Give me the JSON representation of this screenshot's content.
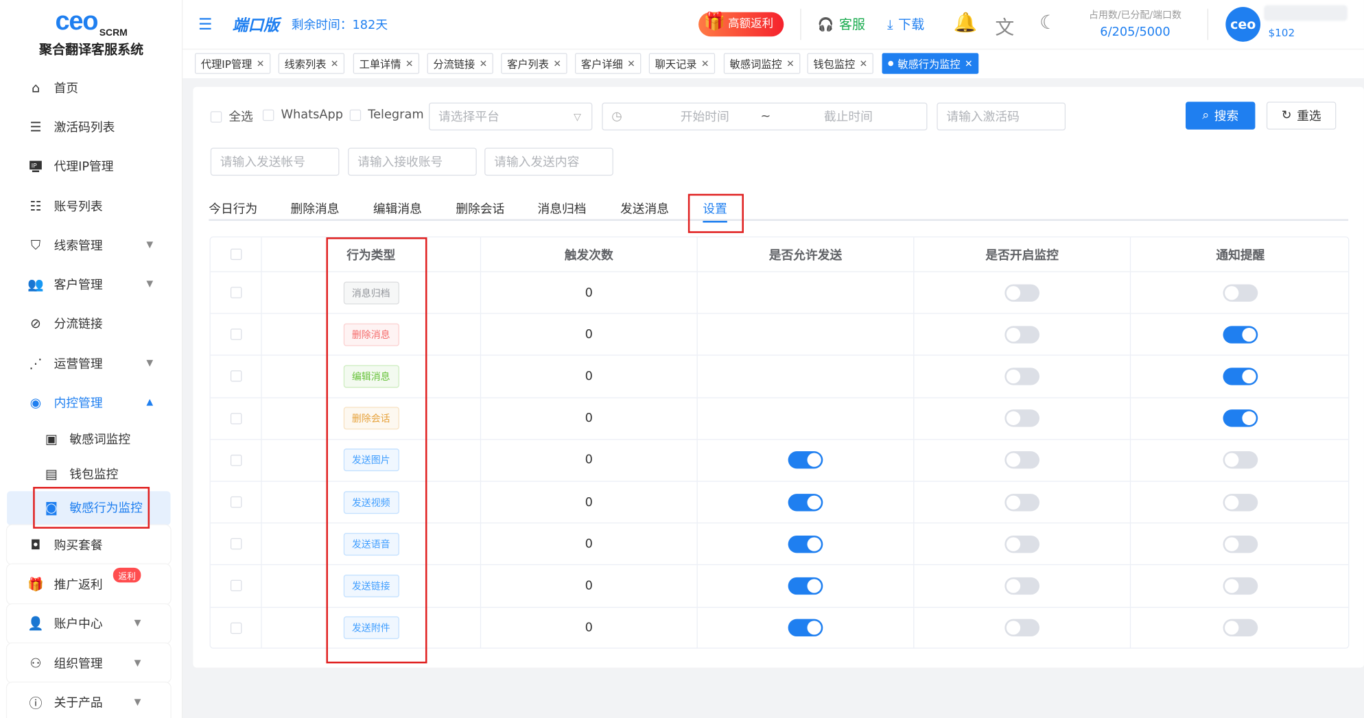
{
  "sidebar": {
    "logo_brand": "ceo",
    "logo_suffix": "SCRM",
    "system_name": "聚合翻译客服系统",
    "items": [
      {
        "label": "首页"
      },
      {
        "label": "激活码列表"
      },
      {
        "label": "代理IP管理"
      },
      {
        "label": "账号列表"
      },
      {
        "label": "线索管理"
      },
      {
        "label": "客户管理"
      },
      {
        "label": "分流链接"
      },
      {
        "label": "运营管理"
      },
      {
        "label": "内控管理"
      },
      {
        "label": "敏感词监控"
      },
      {
        "label": "钱包监控"
      },
      {
        "label": "敏感行为监控"
      },
      {
        "label": "购买套餐"
      },
      {
        "label": "推广返利"
      },
      {
        "label": "账户中心"
      },
      {
        "label": "组织管理"
      },
      {
        "label": "关于产品"
      }
    ],
    "rebate_badge": "返利"
  },
  "header": {
    "edition": "端口版",
    "remaining": "剩余时间：182天",
    "promo": "高额返利",
    "service": "客服",
    "download": "下载",
    "usage_label": "占用数/已分配/端口数",
    "usage_value": "6/205/5000",
    "avatar_text": "ceo",
    "balance": "$102"
  },
  "tabs": [
    {
      "label": "代理IP管理"
    },
    {
      "label": "线索列表"
    },
    {
      "label": "工单详情"
    },
    {
      "label": "分流链接"
    },
    {
      "label": "客户列表"
    },
    {
      "label": "客户详细"
    },
    {
      "label": "聊天记录"
    },
    {
      "label": "敏感词监控"
    },
    {
      "label": "钱包监控"
    },
    {
      "label": "敏感行为监控"
    }
  ],
  "filters": {
    "select_all": "全选",
    "whatsapp": "WhatsApp",
    "telegram": "Telegram",
    "platform_placeholder": "请选择平台",
    "start_time": "开始时间",
    "range_sep": "~",
    "end_time": "截止时间",
    "code_placeholder": "请输入激活码",
    "sender_placeholder": "请输入发送帐号",
    "receiver_placeholder": "请输入接收账号",
    "content_placeholder": "请输入发送内容",
    "search": "搜索",
    "reset": "重选"
  },
  "subtabs": [
    "今日行为",
    "删除消息",
    "编辑消息",
    "删除会话",
    "消息归档",
    "发送消息",
    "设置"
  ],
  "table": {
    "headers": [
      "行为类型",
      "触发次数",
      "是否允许发送",
      "是否开启监控",
      "通知提醒"
    ],
    "rows": [
      {
        "type": "消息归档",
        "color": "#909399",
        "count": "0",
        "allow": null,
        "monitor": false,
        "notify": false
      },
      {
        "type": "删除消息",
        "color": "#f56c6c",
        "count": "0",
        "allow": null,
        "monitor": false,
        "notify": true
      },
      {
        "type": "编辑消息",
        "color": "#67c23a",
        "count": "0",
        "allow": null,
        "monitor": false,
        "notify": true
      },
      {
        "type": "删除会话",
        "color": "#e6a23c",
        "count": "0",
        "allow": null,
        "monitor": false,
        "notify": true
      },
      {
        "type": "发送图片",
        "color": "#409eff",
        "count": "0",
        "allow": true,
        "monitor": false,
        "notify": false
      },
      {
        "type": "发送视频",
        "color": "#409eff",
        "count": "0",
        "allow": true,
        "monitor": false,
        "notify": false
      },
      {
        "type": "发送语音",
        "color": "#409eff",
        "count": "0",
        "allow": true,
        "monitor": false,
        "notify": false
      },
      {
        "type": "发送链接",
        "color": "#409eff",
        "count": "0",
        "allow": true,
        "monitor": false,
        "notify": false
      },
      {
        "type": "发送附件",
        "color": "#409eff",
        "count": "0",
        "allow": true,
        "monitor": false,
        "notify": false
      }
    ]
  },
  "colors": {
    "accent": "#1f7ff0",
    "highlight": "#e02020"
  }
}
